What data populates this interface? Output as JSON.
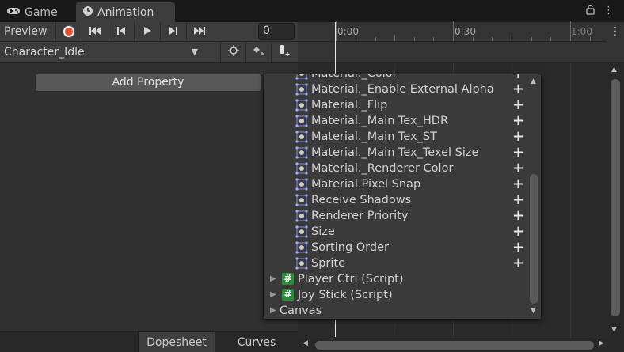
{
  "tabs": [
    {
      "label": "Game",
      "icon": "gamepad-icon",
      "active": false
    },
    {
      "label": "Animation",
      "icon": "clock-icon",
      "active": true
    }
  ],
  "toolbar": {
    "preview_label": "Preview",
    "frame_value": "0",
    "record_color": "#e8522d"
  },
  "timeline": {
    "labels": [
      "0:00",
      "0:30",
      "1:00"
    ]
  },
  "clip": {
    "selected": "Character_Idle"
  },
  "left_panel": {
    "add_property_label": "Add Property"
  },
  "popup": {
    "properties": [
      "Material._Color",
      "Material._Enable External Alpha",
      "Material._Flip",
      "Material._Main Tex_HDR",
      "Material._Main Tex_ST",
      "Material._Main Tex_Texel Size",
      "Material._Renderer Color",
      "Material.Pixel Snap",
      "Receive Shadows",
      "Renderer Priority",
      "Size",
      "Sorting Order",
      "Sprite"
    ],
    "components": [
      {
        "label": "Player Ctrl (Script)",
        "script": true
      },
      {
        "label": "Joy Stick (Script)",
        "script": true
      },
      {
        "label": "Canvas",
        "script": false
      }
    ]
  },
  "bottom": {
    "dopesheet_label": "Dopesheet",
    "curves_label": "Curves"
  },
  "colors": {
    "accent_script": "#2d8a3a",
    "playhead": "#e8e8e8"
  }
}
